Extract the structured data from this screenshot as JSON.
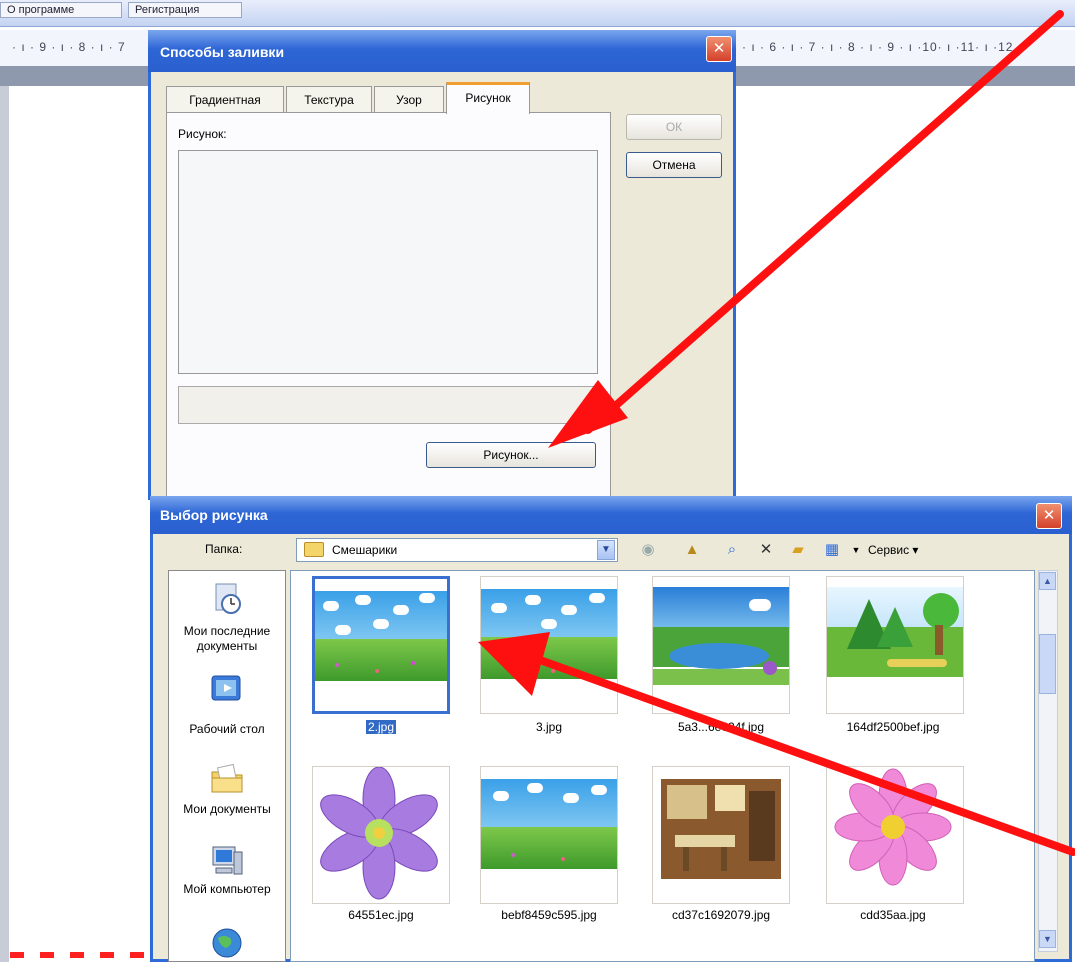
{
  "word": {
    "toolbar_left": "О программе",
    "toolbar_right": "Регистрация",
    "ruler_left": "· ı · 9 · ı · 8 · ı · 7",
    "ruler_right": "· ı · 6 · ı · 7 · ı · 8 · ı · 9 · ı ·10· ı ·11· ı ·12"
  },
  "fill_dialog": {
    "title": "Способы заливки",
    "tabs": [
      "Градиентная",
      "Текстура",
      "Узор",
      "Рисунок"
    ],
    "active_tab": "Рисунок",
    "picture_label": "Рисунок:",
    "ok_label": "ОК",
    "cancel_label": "Отмена",
    "picture_button_label": "Рисунок..."
  },
  "open_dialog": {
    "title": "Выбор рисунка",
    "folder_label": "Папка:",
    "folder_value": "Смешарики",
    "service_label": "Сервис",
    "places": [
      {
        "label": "Мои последние документы",
        "icon": "recent-documents-icon"
      },
      {
        "label": "Рабочий стол",
        "icon": "desktop-icon"
      },
      {
        "label": "Мои документы",
        "icon": "my-documents-icon"
      },
      {
        "label": "Мой компьютер",
        "icon": "my-computer-icon"
      },
      {
        "label": "",
        "icon": "network-places-icon"
      }
    ],
    "files": [
      {
        "name": "2.jpg",
        "selected": true,
        "scene": "meadow"
      },
      {
        "name": "3.jpg",
        "selected": false,
        "scene": "meadow"
      },
      {
        "name": "5a3...6e624f.jpg",
        "selected": false,
        "scene": "lake"
      },
      {
        "name": "164df2500bef.jpg",
        "selected": false,
        "scene": "trees"
      },
      {
        "name": "64551ec.jpg",
        "selected": false,
        "scene": "violet-flower"
      },
      {
        "name": "bebf8459c595.jpg",
        "selected": false,
        "scene": "meadow"
      },
      {
        "name": "cd37c1692079.jpg",
        "selected": false,
        "scene": "room"
      },
      {
        "name": "cdd35aa.jpg",
        "selected": false,
        "scene": "pink-flower"
      }
    ]
  },
  "colors": {
    "title_bar": "#2e66d6",
    "dialog_bg": "#ece9d8",
    "selection": "#316ac5",
    "annotation_arrow": "#ff1010"
  }
}
